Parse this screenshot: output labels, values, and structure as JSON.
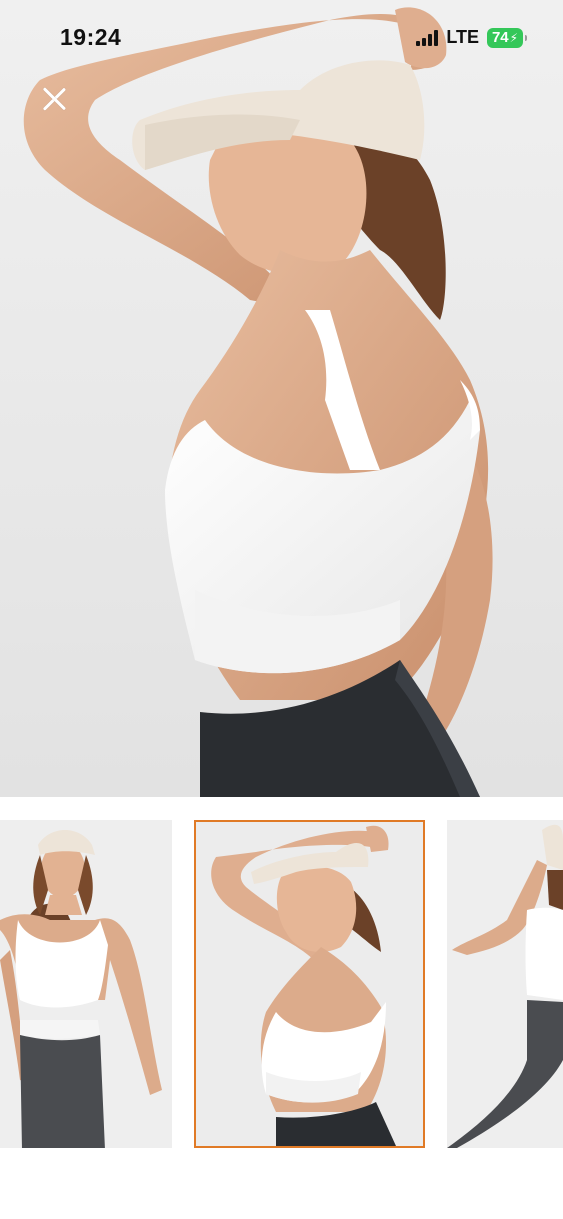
{
  "status_bar": {
    "time": "19:24",
    "network": "LTE",
    "battery_level": "74",
    "battery_charging_symbol": "⚡"
  },
  "viewer": {
    "close_icon": "close-icon",
    "main_image_description_icon": "product-photo",
    "selected_thumbnail_index": 1,
    "thumbnail_count_visible": 3,
    "accent_color": "#e07a26"
  },
  "colors": {
    "battery": "#34c759",
    "background": "#ffffff"
  }
}
